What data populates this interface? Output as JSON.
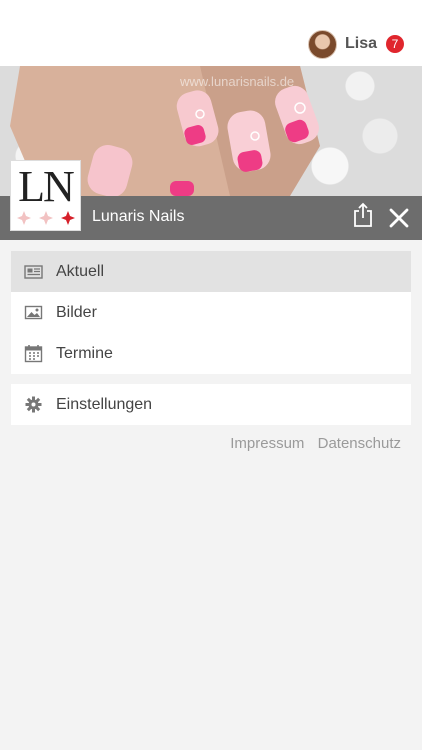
{
  "user": {
    "name": "Lisa",
    "notifications": "7",
    "avatar_icon": "user-avatar"
  },
  "hero": {
    "watermark": "www.lunarisnails.de"
  },
  "logo": {
    "letters": "LN",
    "flower_colors": [
      "#f2c2c2",
      "#f2c2c2",
      "#d6202a"
    ]
  },
  "titlebar": {
    "app_name": "Lunaris Nails",
    "share_icon": "share-icon",
    "close_icon": "close-icon"
  },
  "menu": {
    "main": [
      {
        "label": "Aktuell",
        "icon": "news-icon",
        "active": true
      },
      {
        "label": "Bilder",
        "icon": "image-icon",
        "active": false
      },
      {
        "label": "Termine",
        "icon": "calendar-icon",
        "active": false
      }
    ],
    "settings": [
      {
        "label": "Einstellungen",
        "icon": "gear-icon",
        "active": false
      }
    ]
  },
  "footer_links": {
    "impressum": "Impressum",
    "datenschutz": "Datenschutz"
  },
  "colors": {
    "accent_badge": "#e0262d",
    "titlebar": "#6d6d6d",
    "active_item": "#e2e2e2"
  }
}
